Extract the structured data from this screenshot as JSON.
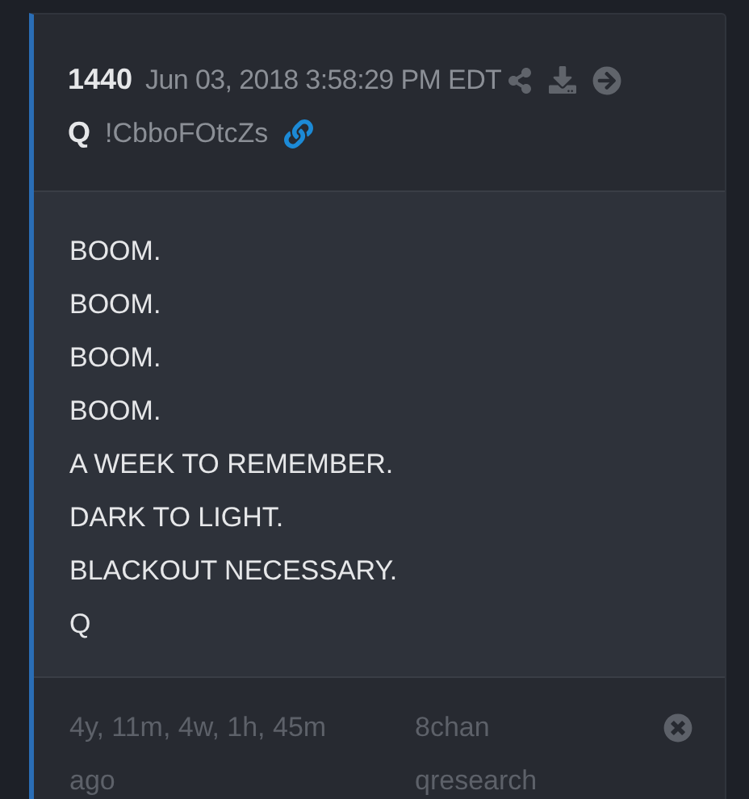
{
  "post": {
    "number": "1440",
    "timestamp": "Jun 03, 2018 3:58:29 PM EDT",
    "author": "Q",
    "tripcode": "!CbboFOtcZs",
    "lines": [
      "BOOM.",
      "BOOM.",
      "BOOM.",
      "BOOM.",
      "A WEEK TO REMEMBER.",
      "DARK TO LIGHT.",
      "BLACKOUT NECESSARY.",
      "Q"
    ],
    "age": "4y, 11m, 4w, 1h, 45m ago",
    "source": "8chan qresearch"
  }
}
